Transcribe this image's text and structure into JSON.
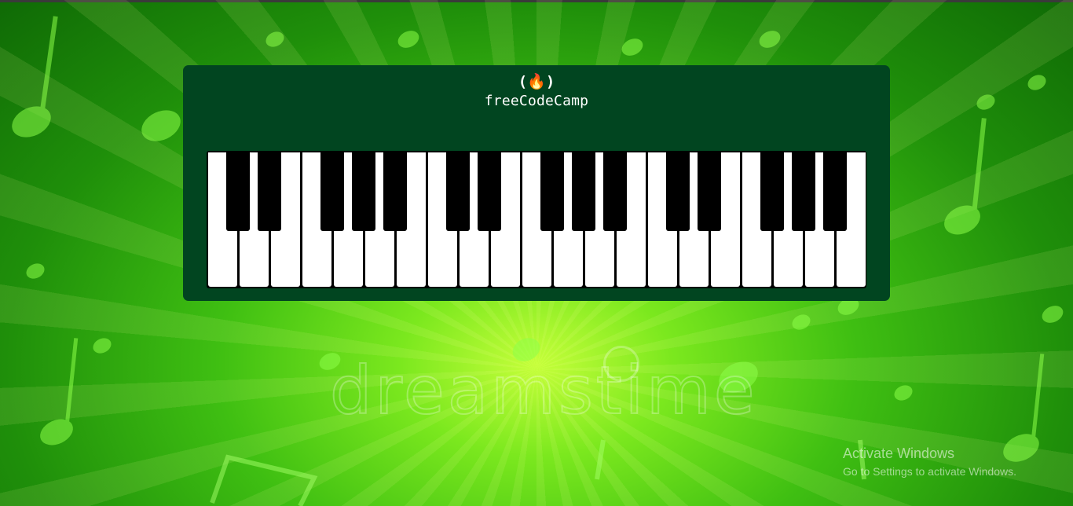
{
  "brand": {
    "icon": "(🔥)",
    "name": "freeCodeCamp"
  },
  "piano": {
    "white_key_count": 21,
    "black_key_count": 15
  },
  "background": {
    "watermark": "dreamstime",
    "theme_color": "#3fbf12",
    "card_color": "#014520"
  },
  "windows_notice": {
    "title": "Activate Windows",
    "subtitle": "Go to Settings to activate Windows."
  }
}
